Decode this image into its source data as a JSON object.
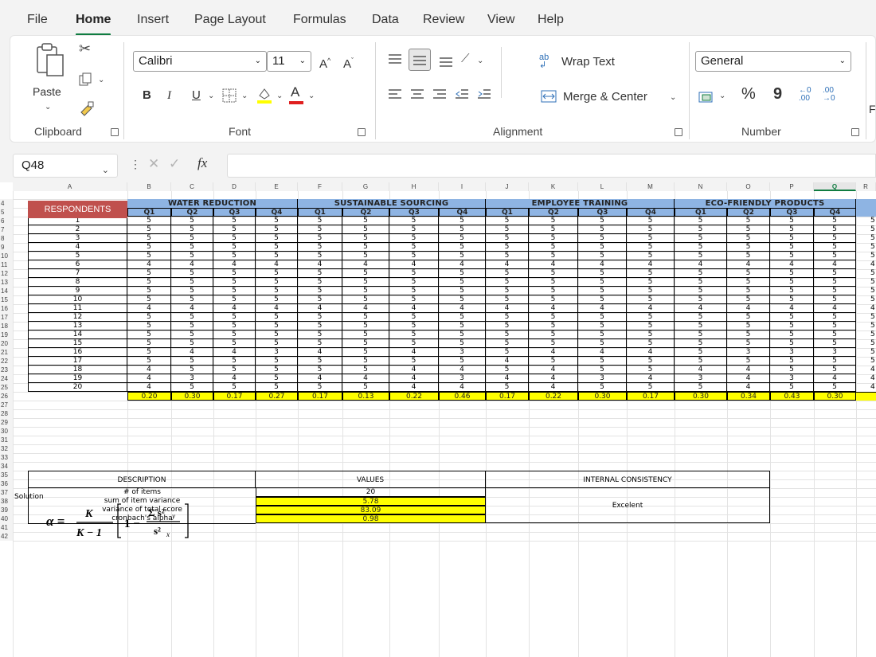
{
  "menu": {
    "tabs": [
      "File",
      "Home",
      "Insert",
      "Page Layout",
      "Formulas",
      "Data",
      "Review",
      "View",
      "Help"
    ],
    "active": "Home"
  },
  "ribbon": {
    "clipboard": {
      "paste": "Paste",
      "label": "Clipboard"
    },
    "font": {
      "name": "Calibri",
      "size": "11",
      "label": "Font",
      "bold": "B",
      "italic": "I",
      "underline": "U",
      "grow": "A^",
      "shrink": "Aˇ",
      "color_letter": "A"
    },
    "alignment": {
      "wrap": "Wrap Text",
      "merge": "Merge & Center",
      "label": "Alignment"
    },
    "number": {
      "format": "General",
      "percent": "%",
      "comma": "9",
      "label": "Number",
      "partial": "F"
    }
  },
  "formula_bar": {
    "name_box": "Q48",
    "cancel": "✕",
    "enter": "✓",
    "fx": "fx",
    "value": ""
  },
  "sheet": {
    "col_letters": [
      "A",
      "B",
      "C",
      "D",
      "E",
      "F",
      "G",
      "H",
      "I",
      "J",
      "K",
      "L",
      "M",
      "N",
      "O",
      "P",
      "Q",
      "R"
    ],
    "selected_col": "Q",
    "respondents_header": "RESPONDENTS",
    "groups": [
      "WATER REDUCTION",
      "SUSTAINABLE SOURCING",
      "EMPLOYEE TRAINING",
      "ECO-FRIENDLY PRODUCTS"
    ],
    "quarters": [
      "Q1",
      "Q2",
      "Q3",
      "Q4"
    ],
    "rows": [
      {
        "r": "1",
        "v": [
          5,
          5,
          5,
          5,
          5,
          5,
          5,
          5,
          5,
          5,
          5,
          5,
          5,
          5,
          5,
          5
        ]
      },
      {
        "r": "2",
        "v": [
          5,
          5,
          5,
          5,
          5,
          5,
          5,
          5,
          5,
          5,
          5,
          5,
          5,
          5,
          5,
          5
        ]
      },
      {
        "r": "3",
        "v": [
          5,
          5,
          5,
          5,
          5,
          5,
          5,
          5,
          5,
          5,
          5,
          5,
          5,
          5,
          5,
          5
        ]
      },
      {
        "r": "4",
        "v": [
          5,
          5,
          5,
          5,
          5,
          5,
          5,
          5,
          5,
          5,
          5,
          5,
          5,
          5,
          5,
          5
        ]
      },
      {
        "r": "5",
        "v": [
          5,
          5,
          5,
          5,
          5,
          5,
          5,
          5,
          5,
          5,
          5,
          5,
          5,
          5,
          5,
          5
        ]
      },
      {
        "r": "6",
        "v": [
          4,
          4,
          4,
          4,
          4,
          4,
          4,
          4,
          4,
          4,
          4,
          4,
          4,
          4,
          4,
          4
        ]
      },
      {
        "r": "7",
        "v": [
          5,
          5,
          5,
          5,
          5,
          5,
          5,
          5,
          5,
          5,
          5,
          5,
          5,
          5,
          5,
          5
        ]
      },
      {
        "r": "8",
        "v": [
          5,
          5,
          5,
          5,
          5,
          5,
          5,
          5,
          5,
          5,
          5,
          5,
          5,
          5,
          5,
          5
        ]
      },
      {
        "r": "9",
        "v": [
          5,
          5,
          5,
          5,
          5,
          5,
          5,
          5,
          5,
          5,
          5,
          5,
          5,
          5,
          5,
          5
        ]
      },
      {
        "r": "10",
        "v": [
          5,
          5,
          5,
          5,
          5,
          5,
          5,
          5,
          5,
          5,
          5,
          5,
          5,
          5,
          5,
          5
        ]
      },
      {
        "r": "11",
        "v": [
          4,
          4,
          4,
          4,
          4,
          4,
          4,
          4,
          4,
          4,
          4,
          4,
          4,
          4,
          4,
          4
        ]
      },
      {
        "r": "12",
        "v": [
          5,
          5,
          5,
          5,
          5,
          5,
          5,
          5,
          5,
          5,
          5,
          5,
          5,
          5,
          5,
          5
        ]
      },
      {
        "r": "13",
        "v": [
          5,
          5,
          5,
          5,
          5,
          5,
          5,
          5,
          5,
          5,
          5,
          5,
          5,
          5,
          5,
          5
        ]
      },
      {
        "r": "14",
        "v": [
          5,
          5,
          5,
          5,
          5,
          5,
          5,
          5,
          5,
          5,
          5,
          5,
          5,
          5,
          5,
          5
        ]
      },
      {
        "r": "15",
        "v": [
          5,
          5,
          5,
          5,
          5,
          5,
          5,
          5,
          5,
          5,
          5,
          5,
          5,
          5,
          5,
          5
        ]
      },
      {
        "r": "16",
        "v": [
          5,
          4,
          4,
          3,
          4,
          5,
          4,
          3,
          5,
          4,
          4,
          4,
          5,
          3,
          3,
          3
        ]
      },
      {
        "r": "17",
        "v": [
          5,
          5,
          5,
          5,
          5,
          5,
          5,
          5,
          4,
          5,
          5,
          5,
          5,
          5,
          5,
          5
        ]
      },
      {
        "r": "18",
        "v": [
          4,
          5,
          5,
          5,
          5,
          5,
          4,
          4,
          5,
          4,
          5,
          5,
          4,
          4,
          5,
          5
        ]
      },
      {
        "r": "19",
        "v": [
          4,
          3,
          4,
          5,
          4,
          4,
          4,
          3,
          4,
          4,
          3,
          4,
          3,
          4,
          3,
          4
        ]
      },
      {
        "r": "20",
        "v": [
          4,
          5,
          5,
          5,
          5,
          5,
          4,
          4,
          5,
          4,
          5,
          5,
          5,
          4,
          5,
          5
        ]
      }
    ],
    "variances": [
      "0.20",
      "0.30",
      "0.17",
      "0.27",
      "0.17",
      "0.13",
      "0.22",
      "0.46",
      "0.17",
      "0.22",
      "0.30",
      "0.17",
      "0.30",
      "0.34",
      "0.43",
      "0.30"
    ],
    "solution_label": "Solution",
    "summary": {
      "headers": [
        "DESCRIPTION",
        "VALUES",
        "INTERNAL CONSISTENCY"
      ],
      "items": [
        {
          "desc": "# of items",
          "value": "20"
        },
        {
          "desc": "sum of item variance",
          "value": "5.78"
        },
        {
          "desc": "variance of total score",
          "value": "83.09"
        },
        {
          "desc": "cronbach's alpha",
          "value": "0.98"
        }
      ],
      "consistency": "Excelent"
    }
  }
}
